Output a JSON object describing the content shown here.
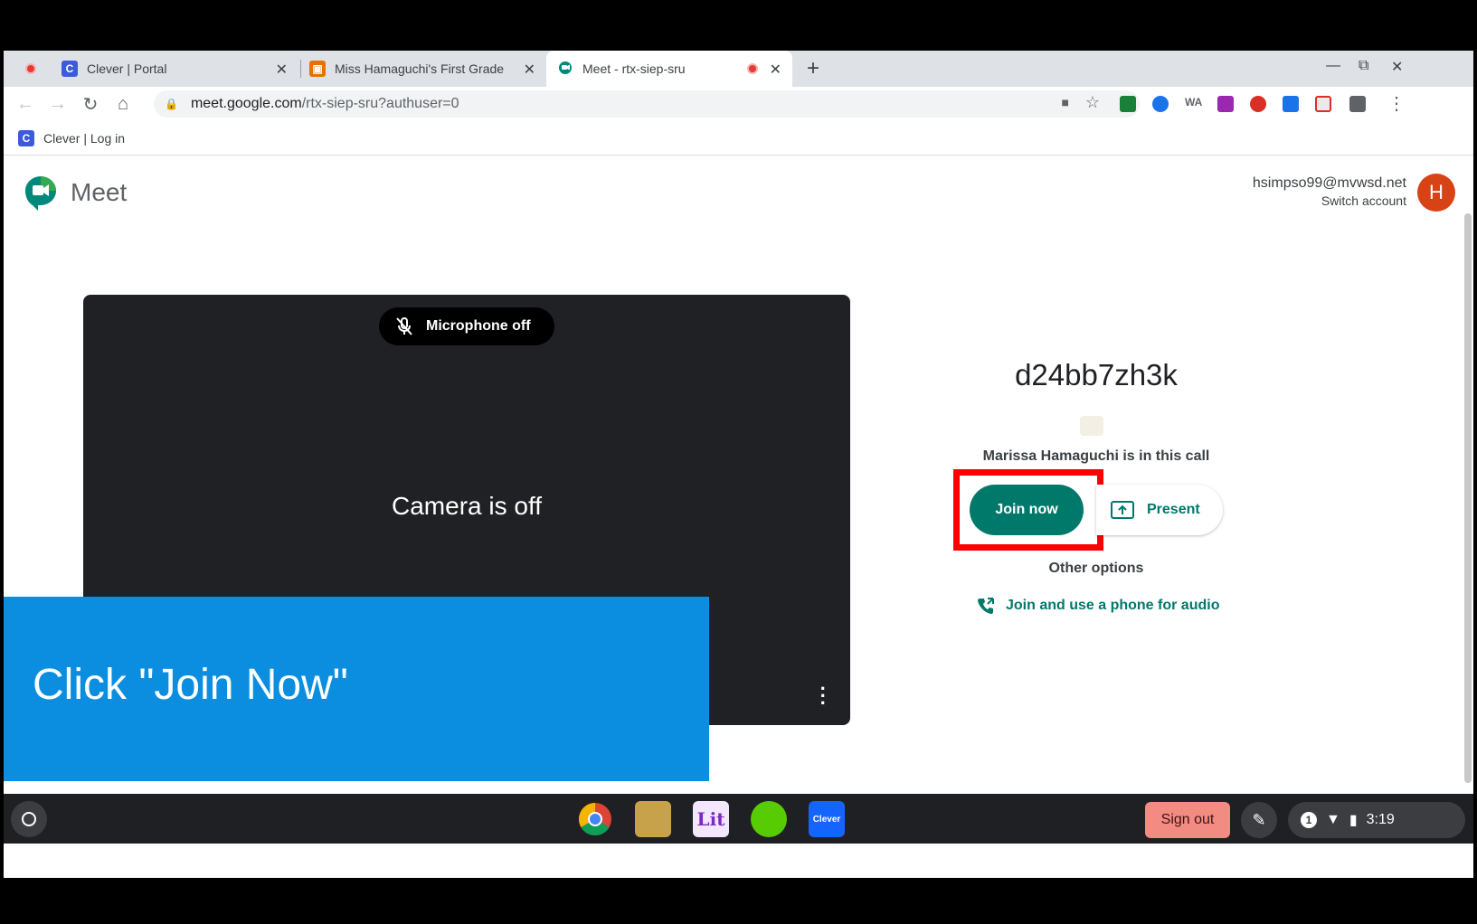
{
  "tabs": [
    {
      "title": "Clever | Portal",
      "icon": "clever-icon"
    },
    {
      "title": "Miss Hamaguchi's First Grade",
      "icon": "classroom-icon"
    },
    {
      "title": "Meet - rtx-siep-sru",
      "icon": "meet-icon",
      "active": true
    }
  ],
  "toolbar": {
    "url_host": "meet.google.com",
    "url_path": "/rtx-siep-sru?authuser=0"
  },
  "bookmarks": [
    {
      "label": "Clever | Log in"
    }
  ],
  "meet": {
    "app_name": "Meet",
    "account_email": "hsimpso99@mvwsd.net",
    "switch_account": "Switch account",
    "avatar_letter": "H",
    "mic_status": "Microphone off",
    "camera_status": "Camera is off",
    "meeting_code": "d24bb7zh3k",
    "in_call_text": "Marissa Hamaguchi is in this call",
    "join_label": "Join now",
    "present_label": "Present",
    "other_options": "Other options",
    "phone_audio": "Join and use a phone for audio"
  },
  "overlay": {
    "caption": "Click \"Join Now\""
  },
  "shelf": {
    "sign_out": "Sign out",
    "clock": "3:19",
    "notification_count": "1",
    "apps": [
      "chrome",
      "reader-app",
      "lit-app",
      "duolingo-app",
      "clever-app"
    ],
    "clever_label": "Clever"
  },
  "colors": {
    "meet_green": "#00796b",
    "highlight_red": "#ff0000",
    "overlay_blue": "#0b8ee0"
  }
}
